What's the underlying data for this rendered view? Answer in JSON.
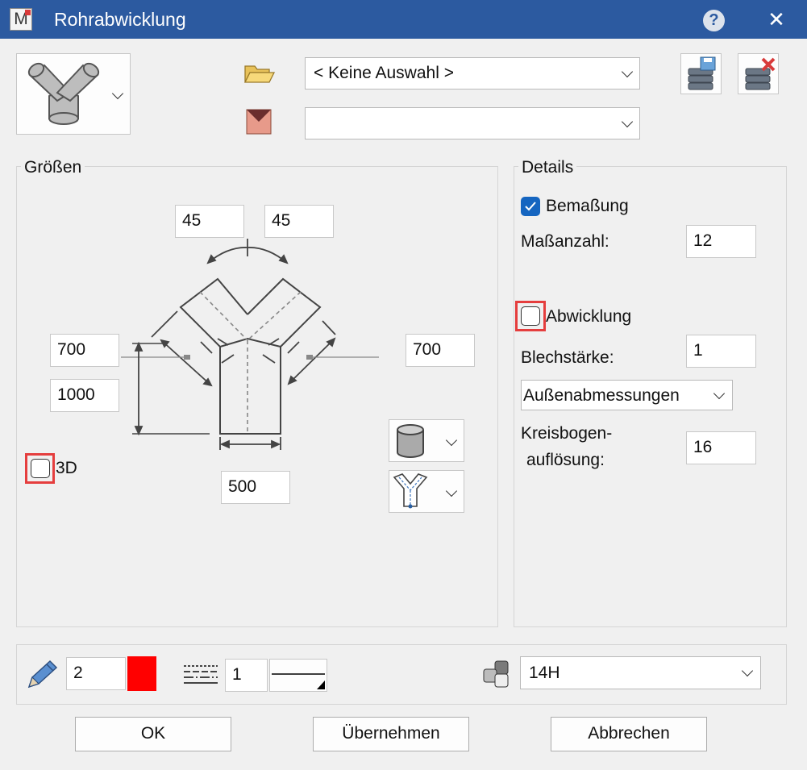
{
  "window": {
    "title": "Rohrabwicklung",
    "app_icon_letter": "M",
    "help": "?",
    "close": "✕"
  },
  "top": {
    "library_combo_value": "< Keine Auswahl >",
    "format_combo_value": ""
  },
  "sizes": {
    "title": "Größen",
    "angle_left": "45",
    "angle_right": "45",
    "left_branch_length": "700",
    "total_height": "1000",
    "right_branch_length": "700",
    "width": "500",
    "three_d_label": "3D",
    "three_d_checked": false
  },
  "details": {
    "title": "Details",
    "dimensioning_label": "Bemaßung",
    "dimensioning_checked": true,
    "dim_count_label": "Maßanzahl:",
    "dim_count_value": "12",
    "unfold_label": "Abwicklung",
    "unfold_checked": false,
    "sheet_thickness_label": "Blechstärke:",
    "sheet_thickness_value": "1",
    "dimension_mode_value": "Außenabmessungen",
    "arc_resolution_label_1": "Kreisbogen-",
    "arc_resolution_label_2": "auflösung:",
    "arc_resolution_value": "16"
  },
  "bottom": {
    "pen_value": "2",
    "pen_color": "#ff0000",
    "linetype_value": "1",
    "layer_value": "14H"
  },
  "buttons": {
    "ok": "OK",
    "apply": "Übernehmen",
    "cancel": "Abbrechen"
  },
  "colors": {
    "titlebar": "#2c5aa0",
    "checkbox_checked": "#1565c0",
    "highlight": "#e53e3e"
  }
}
